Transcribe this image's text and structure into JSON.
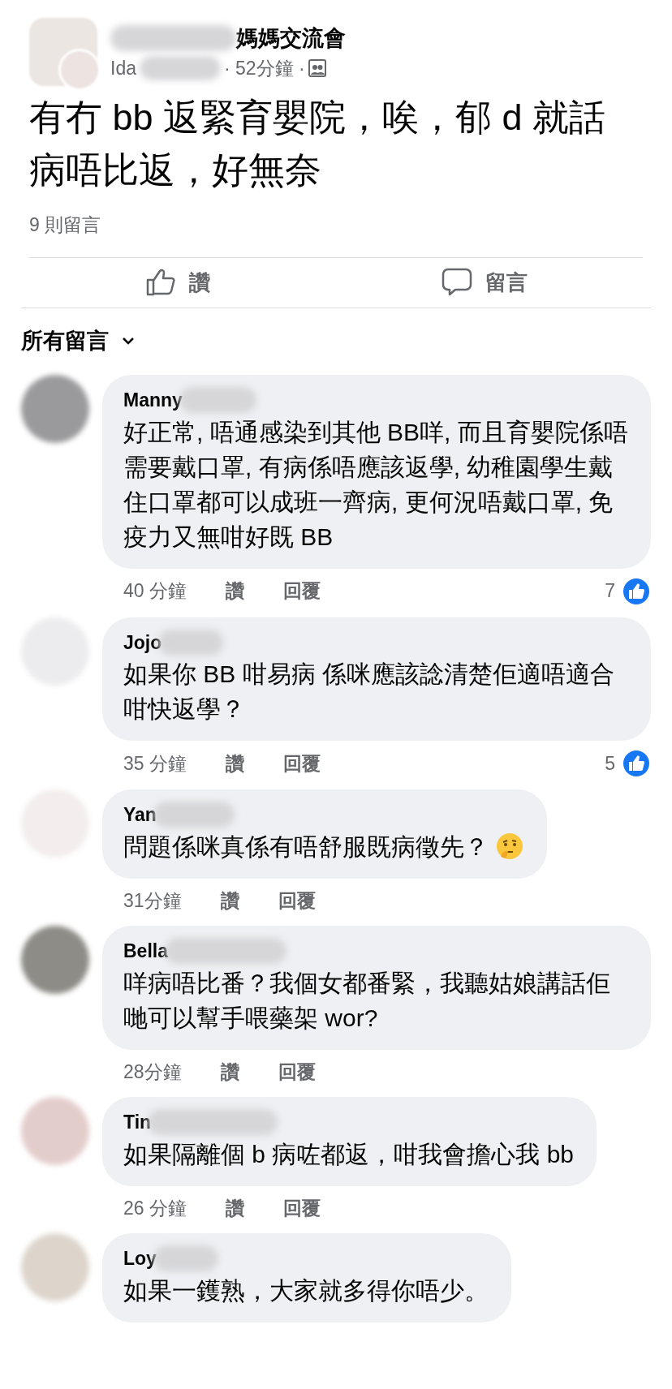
{
  "post": {
    "group_suffix": "媽媽交流會",
    "author_prefix": "Ida",
    "time": "· 52分鐘 ·",
    "text": "有冇 bb 返緊育嬰院，唉，郁 d 就話病唔比返，好無奈",
    "comment_count": "9 則留言"
  },
  "actions": [
    {
      "kind": "like",
      "label": "讚"
    },
    {
      "kind": "comment",
      "label": "留言"
    }
  ],
  "filter": {
    "label": "所有留言"
  },
  "comments": [
    {
      "name": "Manny",
      "color": "#9a9a9c",
      "text": "好正常, 唔通感染到其他 BB咩, 而且育嬰院係唔需要戴口罩, 有病係唔應該返學, 幼稚園學生戴住口罩都可以成班一齊病, 更何況唔戴口罩, 免疫力又無咁好既 BB",
      "time": "40 分鐘",
      "like": "讚",
      "reply": "回覆",
      "reactions": "7"
    },
    {
      "name": "Jojo",
      "color": "#ececee",
      "text": "如果你 BB 咁易病 係咪應該諗清楚佢適唔適合咁快返學？",
      "time": "35 分鐘",
      "like": "讚",
      "reply": "回覆",
      "reactions": "5"
    },
    {
      "name": "Yan",
      "color": "#f3eded",
      "text": "問題係咪真係有唔舒服既病徵先？",
      "emoji": true,
      "time": "31分鐘",
      "like": "讚",
      "reply": "回覆"
    },
    {
      "name": "Bella",
      "color": "#8d8c86",
      "text": "咩病唔比番？我個女都番緊，我聽姑娘講話佢哋可以幫手喂藥架 wor?",
      "time": "28分鐘",
      "like": "讚",
      "reply": "回覆"
    },
    {
      "name": "Tin",
      "color": "#e3cdcb",
      "text": "如果隔離個 b 病咗都返，咁我會擔心我 bb",
      "time": "26 分鐘",
      "like": "讚",
      "reply": "回覆"
    },
    {
      "name": "Loy",
      "color": "#ddd5cc",
      "text": "如果一鑊熟，大家就多得你唔少。"
    }
  ]
}
